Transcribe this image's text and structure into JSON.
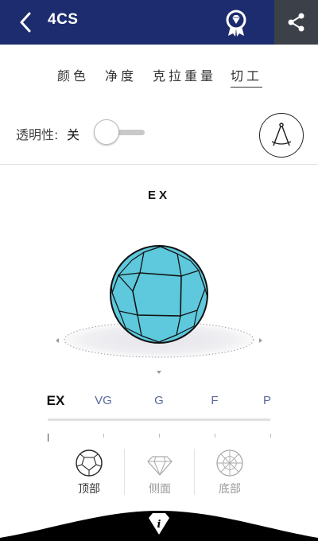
{
  "header": {
    "title": "4CS",
    "background": "#1d2c6e",
    "share_background": "#3b4049",
    "icons": [
      "back-arrow-icon",
      "certificate-badge-icon",
      "share-icon"
    ]
  },
  "tabs": [
    {
      "label": "颜色",
      "active": false
    },
    {
      "label": "净度",
      "active": false
    },
    {
      "label": "克拉重量",
      "active": false
    },
    {
      "label": "切工",
      "active": true
    }
  ],
  "transparency": {
    "label": "透明性:",
    "value": "关",
    "on": false
  },
  "tools": {
    "compass_icon": "compass-divider-icon"
  },
  "grade": {
    "current": "EX",
    "diamond_color": "#5ec8dc"
  },
  "scale": {
    "grades": [
      "EX",
      "VG",
      "G",
      "F",
      "P"
    ],
    "selected": "EX"
  },
  "views": [
    {
      "label": "顶部",
      "icon": "diamond-top-icon",
      "active": true
    },
    {
      "label": "侧面",
      "icon": "diamond-side-icon",
      "active": false
    },
    {
      "label": "底部",
      "icon": "diamond-bottom-icon",
      "active": false
    }
  ],
  "footer": {
    "info_icon": "info-icon"
  }
}
